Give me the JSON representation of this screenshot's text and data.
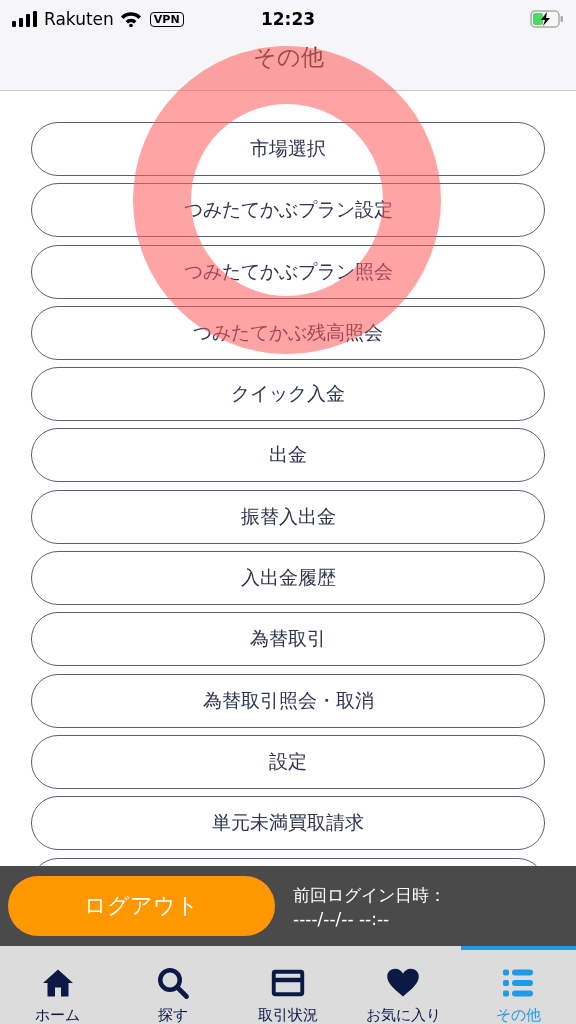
{
  "status_bar": {
    "carrier": "Rakuten",
    "vpn_badge": "VPN",
    "time": "12:23"
  },
  "header": {
    "title": "その他"
  },
  "menu_items": [
    {
      "label": "市場選択"
    },
    {
      "label": "つみたてかぶプラン設定"
    },
    {
      "label": "つみたてかぶプラン照会"
    },
    {
      "label": "つみたてかぶ残高照会"
    },
    {
      "label": "クイック入金"
    },
    {
      "label": "出金"
    },
    {
      "label": "振替入出金"
    },
    {
      "label": "入出金履歴"
    },
    {
      "label": "為替取引"
    },
    {
      "label": "為替取引照会・取消"
    },
    {
      "label": "設定"
    },
    {
      "label": "単元未満買取請求"
    }
  ],
  "logout_button": "ログアウト",
  "last_login": {
    "label": "前回ログイン日時：",
    "value": "----/--/-- --:--"
  },
  "tabs": [
    {
      "label": "ホーム",
      "selected": false
    },
    {
      "label": "探す",
      "selected": false
    },
    {
      "label": "取引状況",
      "selected": false
    },
    {
      "label": "お気に入り",
      "selected": false
    },
    {
      "label": "その他",
      "selected": true
    }
  ]
}
